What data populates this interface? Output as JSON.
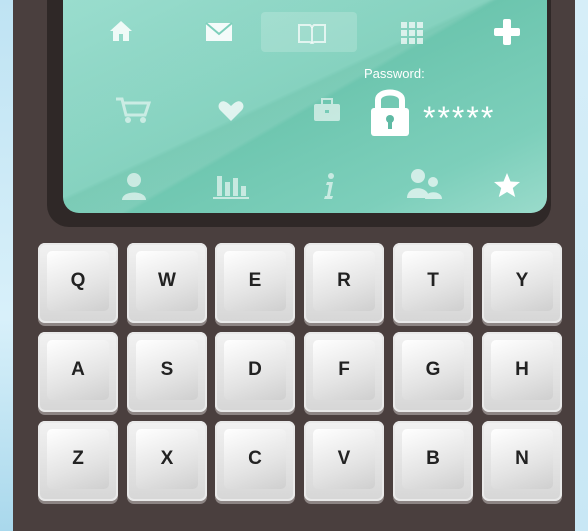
{
  "screen": {
    "password_label": "Password:",
    "password_mask": "*****",
    "icons": [
      {
        "name": "home-icon"
      },
      {
        "name": "mail-icon"
      },
      {
        "name": "book-icon"
      },
      {
        "name": "grid-icon"
      },
      {
        "name": "plus-icon"
      },
      {
        "name": "cart-icon"
      },
      {
        "name": "heart-icon"
      },
      {
        "name": "briefcase-icon"
      },
      {
        "name": "lock-icon"
      },
      {
        "name": "user-icon"
      },
      {
        "name": "bar-chart-icon"
      },
      {
        "name": "info-icon"
      },
      {
        "name": "users-icon"
      },
      {
        "name": "star-icon"
      }
    ]
  },
  "keyboard": {
    "rows": [
      [
        "Q",
        "W",
        "E",
        "R",
        "T",
        "Y"
      ],
      [
        "A",
        "S",
        "D",
        "F",
        "G",
        "H"
      ],
      [
        "Z",
        "X",
        "C",
        "V",
        "B",
        "N"
      ]
    ]
  },
  "colors": {
    "screen": "#7dcfbb",
    "device": "#4a3f3e",
    "key": "#e4e4e4"
  }
}
